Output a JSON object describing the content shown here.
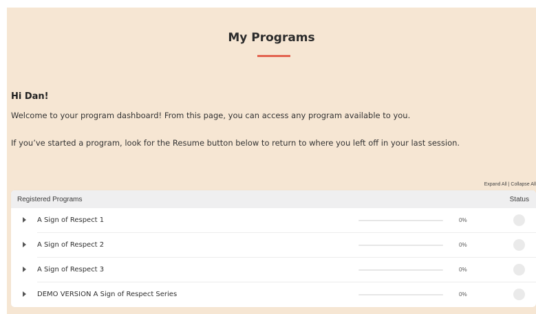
{
  "header": {
    "title": "My Programs"
  },
  "intro": {
    "greeting": "Hi Dan!",
    "paragraph1": "Welcome to your program dashboard!  From this page, you can access any program available to you.",
    "paragraph2": "If you’ve started a program, look for the Resume button below to return to where you left off in your last session."
  },
  "controls": {
    "expand_all": "Expand All",
    "separator": " | ",
    "collapse_all": "Collapse All"
  },
  "programs": {
    "header_label": "Registered Programs",
    "status_label": "Status",
    "items": [
      {
        "name": "A Sign of Respect 1",
        "percent": "0%",
        "progress": 0
      },
      {
        "name": "A Sign of Respect 2",
        "percent": "0%",
        "progress": 0
      },
      {
        "name": "A Sign of Respect 3",
        "percent": "0%",
        "progress": 0
      },
      {
        "name": "DEMO VERSION A Sign of Respect Series",
        "percent": "0%",
        "progress": 0
      }
    ]
  },
  "colors": {
    "page_background": "#f6e6d3",
    "accent": "#e25f4b",
    "status_icon": "#eaeaea"
  },
  "icons": {
    "row_expander": "caret-right-icon",
    "status": "status-circle-icon"
  }
}
